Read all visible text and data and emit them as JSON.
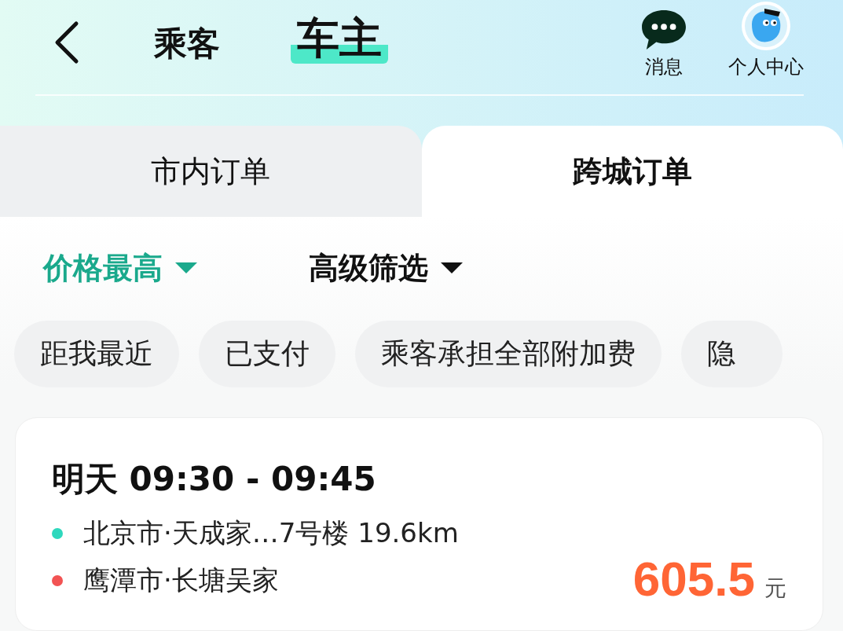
{
  "header": {
    "roles": [
      {
        "label": "乘客",
        "selected": false
      },
      {
        "label": "车主",
        "selected": true
      }
    ],
    "actions": [
      {
        "kind": "message",
        "label": "消息"
      },
      {
        "kind": "profile",
        "label": "个人中心"
      }
    ]
  },
  "order_tabs": [
    {
      "label": "市内订单",
      "selected": false
    },
    {
      "label": "跨城订单",
      "selected": true
    }
  ],
  "sort": [
    {
      "label": "价格最高",
      "selected": true
    },
    {
      "label": "高级筛选",
      "selected": false
    }
  ],
  "chips": [
    "距我最近",
    "已支付",
    "乘客承担全部附加费",
    "隐"
  ],
  "order": {
    "time": "明天 09:30 - 09:45",
    "stops": [
      {
        "text": "北京市·天成家…7号楼 19.6km",
        "color": "#2ed8bd"
      },
      {
        "text": "鹰潭市·长塘吴家",
        "color": "#f25353"
      }
    ],
    "price": "605.5",
    "unit": "元"
  }
}
